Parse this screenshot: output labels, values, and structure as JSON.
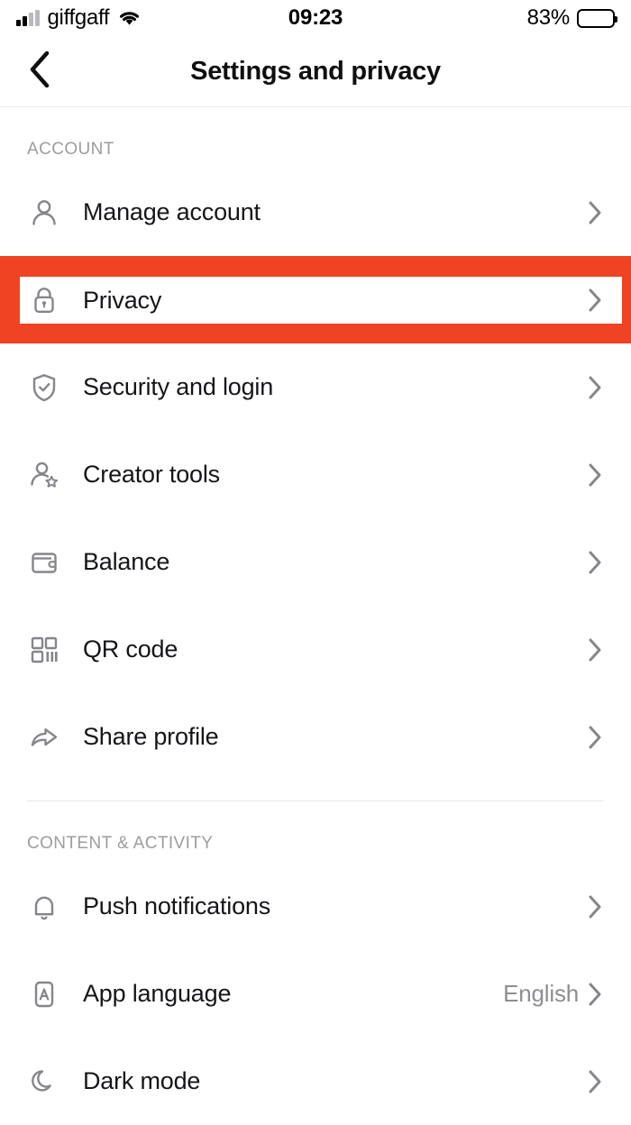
{
  "status_bar": {
    "carrier": "giffgaff",
    "time": "09:23",
    "battery_percent": "83%",
    "signal_icon": "signal-bars-icon",
    "wifi_icon": "wifi-icon",
    "battery_icon": "battery-icon"
  },
  "header": {
    "title": "Settings and privacy",
    "back_icon": "chevron-left-icon"
  },
  "sections": [
    {
      "title": "ACCOUNT",
      "items": [
        {
          "label": "Manage account",
          "icon": "person-icon",
          "value": "",
          "highlighted": false
        },
        {
          "label": "Privacy",
          "icon": "lock-icon",
          "value": "",
          "highlighted": true
        },
        {
          "label": "Security and login",
          "icon": "shield-check-icon",
          "value": "",
          "highlighted": false
        },
        {
          "label": "Creator tools",
          "icon": "person-star-icon",
          "value": "",
          "highlighted": false
        },
        {
          "label": "Balance",
          "icon": "wallet-icon",
          "value": "",
          "highlighted": false
        },
        {
          "label": "QR code",
          "icon": "qr-code-icon",
          "value": "",
          "highlighted": false
        },
        {
          "label": "Share profile",
          "icon": "share-arrow-icon",
          "value": "",
          "highlighted": false
        }
      ]
    },
    {
      "title": "CONTENT & ACTIVITY",
      "items": [
        {
          "label": "Push notifications",
          "icon": "bell-icon",
          "value": "",
          "highlighted": false
        },
        {
          "label": "App language",
          "icon": "letter-a-box-icon",
          "value": "English",
          "highlighted": false
        },
        {
          "label": "Dark mode",
          "icon": "moon-icon",
          "value": "",
          "highlighted": false
        }
      ]
    }
  ],
  "colors": {
    "highlight": "#ef4323",
    "icon_gray": "#85858b",
    "text": "#16161a",
    "muted": "#9d9da1"
  }
}
